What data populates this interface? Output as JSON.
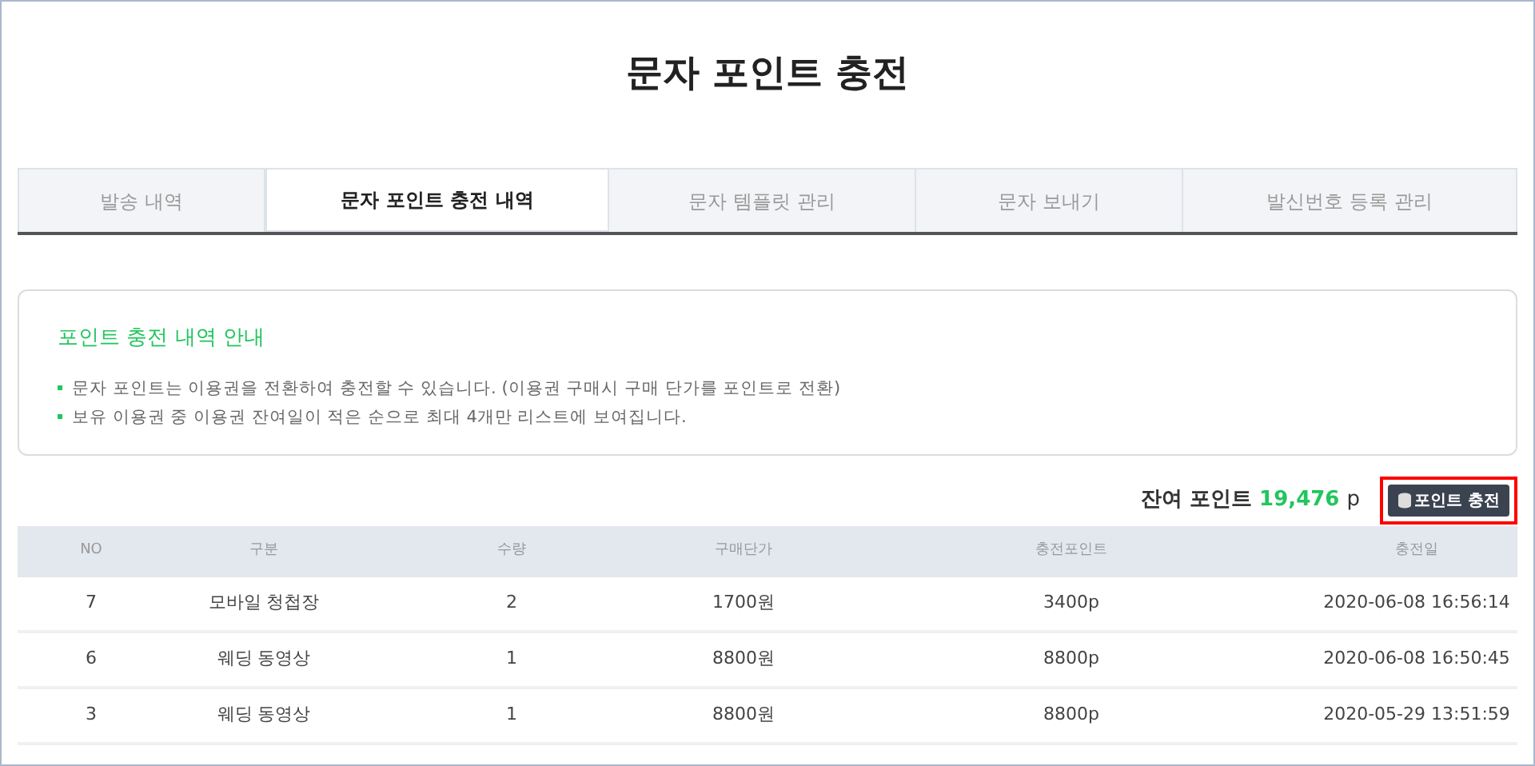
{
  "title": "문자 포인트 충전",
  "tabs": [
    {
      "label": "발송 내역",
      "selected": false
    },
    {
      "label": "문자 포인트 충전 내역",
      "selected": true
    },
    {
      "label": "문자 템플릿 관리",
      "selected": false
    },
    {
      "label": "문자 보내기",
      "selected": false
    },
    {
      "label": "발신번호 등록 관리",
      "selected": false
    }
  ],
  "notice": {
    "title": "포인트 충전 내역 안내",
    "items": [
      "문자 포인트는 이용권을 전환하여 충전할 수 있습니다. (이용권 구매시 구매 단가를 포인트로 전환)",
      "보유 이용권 중 이용권 잔여일이 적은 순으로 최대 4개만 리스트에 보여집니다."
    ]
  },
  "balance": {
    "label": "잔여 포인트",
    "value": "19,476",
    "unit": "p"
  },
  "charge_button": {
    "label": "포인트 충전",
    "highlighted": true
  },
  "table": {
    "columns": [
      "NO",
      "구분",
      "수량",
      "구매단가",
      "충전포인트",
      "충전일"
    ],
    "rows": [
      [
        "7",
        "모바일 청첩장",
        "2",
        "1700원",
        "3400p",
        "2020-06-08 16:56:14"
      ],
      [
        "6",
        "웨딩 동영상",
        "1",
        "8800원",
        "8800p",
        "2020-06-08 16:50:45"
      ],
      [
        "3",
        "웨딩 동영상",
        "1",
        "8800원",
        "8800p",
        "2020-05-29 13:51:59"
      ]
    ]
  }
}
